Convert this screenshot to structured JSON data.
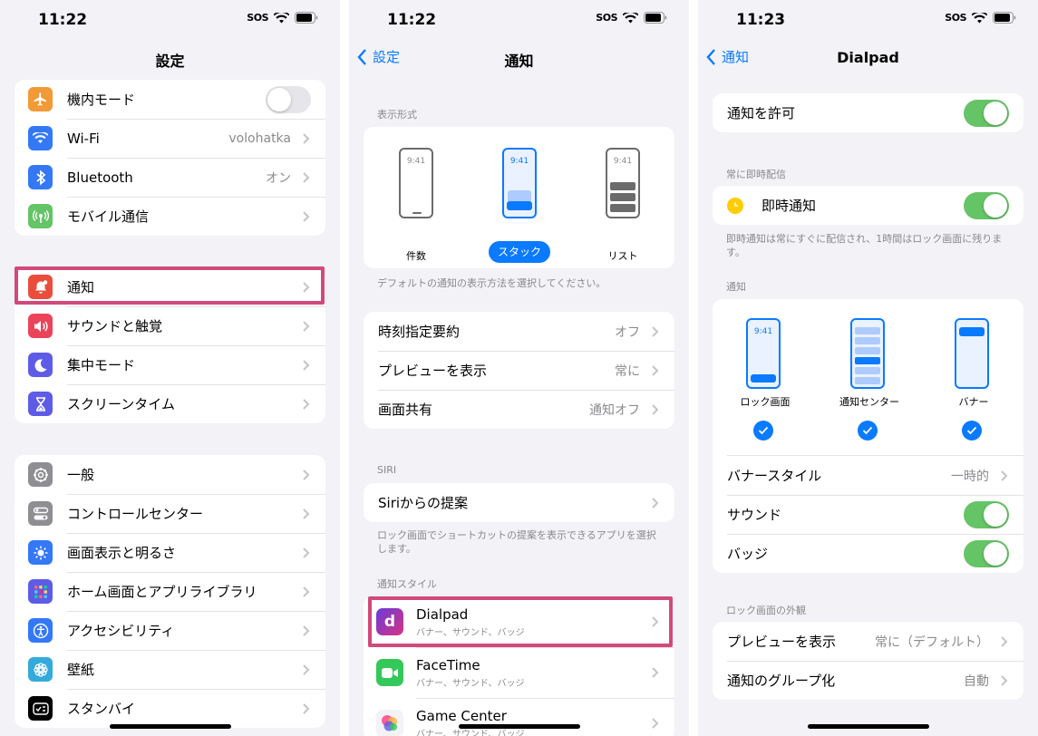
{
  "screen1": {
    "time": "11:22",
    "sos": "SOS",
    "title": "設定",
    "group1": [
      {
        "label": "機内モード",
        "icon": "airplane-icon",
        "color": "#f19a37",
        "toggle": "off"
      },
      {
        "label": "Wi-Fi",
        "value": "volohatka",
        "icon": "wifi-icon",
        "color": "#3478f6"
      },
      {
        "label": "Bluetooth",
        "value": "オン",
        "icon": "bluetooth-icon",
        "color": "#3478f6"
      },
      {
        "label": "モバイル通信",
        "icon": "antenna-icon",
        "color": "#65c466"
      }
    ],
    "group2": [
      {
        "label": "通知",
        "icon": "bell-badge-icon",
        "color": "#eb4d3d"
      },
      {
        "label": "サウンドと触覚",
        "icon": "speaker-icon",
        "color": "#eb445a"
      },
      {
        "label": "集中モード",
        "icon": "moon-icon",
        "color": "#5e5ce6"
      },
      {
        "label": "スクリーンタイム",
        "icon": "hourglass-icon",
        "color": "#5e5ce6"
      }
    ],
    "group3": [
      {
        "label": "一般",
        "icon": "gear-icon",
        "color": "#8e8e93"
      },
      {
        "label": "コントロールセンター",
        "icon": "switches-icon",
        "color": "#8e8e93"
      },
      {
        "label": "画面表示と明るさ",
        "icon": "sun-icon",
        "color": "#3478f6"
      },
      {
        "label": "ホーム画面とアプリライブラリ",
        "icon": "grid-icon",
        "color": "#5e5ce6"
      },
      {
        "label": "アクセシビリティ",
        "icon": "accessibility-icon",
        "color": "#3478f6"
      },
      {
        "label": "壁紙",
        "icon": "flower-icon",
        "color": "#34aadc"
      },
      {
        "label": "スタンバイ",
        "icon": "standby-icon",
        "color": "#000000"
      }
    ]
  },
  "screen2": {
    "time": "11:22",
    "sos": "SOS",
    "back": "設定",
    "title": "通知",
    "display_header": "表示形式",
    "styles": [
      {
        "label": "件数",
        "clock": "9:41",
        "selected": false
      },
      {
        "label": "スタック",
        "clock": "9:41",
        "selected": true
      },
      {
        "label": "リスト",
        "clock": "9:41",
        "selected": false
      }
    ],
    "display_footer": "デフォルトの通知の表示方法を選択してください。",
    "group_settings": [
      {
        "label": "時刻指定要約",
        "value": "オフ"
      },
      {
        "label": "プレビューを表示",
        "value": "常に"
      },
      {
        "label": "画面共有",
        "value": "通知オフ"
      }
    ],
    "siri_header": "SIRI",
    "siri_row": "Siriからの提案",
    "siri_footer": "ロック画面でショートカットの提案を表示できるアプリを選択します。",
    "style_header": "通知スタイル",
    "apps": [
      {
        "name": "Dialpad",
        "sub": "バナー、サウンド、バッジ",
        "icon": "dialpad-app-icon"
      },
      {
        "name": "FaceTime",
        "sub": "バナー、サウンド、バッジ",
        "icon": "facetime-app-icon"
      },
      {
        "name": "Game Center",
        "sub": "バナー、サウンド、バッジ",
        "icon": "game-center-app-icon"
      }
    ]
  },
  "screen3": {
    "time": "11:23",
    "sos": "SOS",
    "back": "通知",
    "title": "Dialpad",
    "allow_label": "通知を許可",
    "immediate_header": "常に即時配信",
    "immediate_label": "即時通知",
    "immediate_footer": "即時通知は常にすぐに配信され、1時間はロック画面に残ります。",
    "notif_header": "通知",
    "locations": [
      {
        "label": "ロック画面",
        "clock": "9:41"
      },
      {
        "label": "通知センター"
      },
      {
        "label": "バナー"
      }
    ],
    "banner_style_label": "バナースタイル",
    "banner_style_value": "一時的",
    "sound_label": "サウンド",
    "badge_label": "バッジ",
    "lock_header": "ロック画面の外観",
    "preview_label": "プレビューを表示",
    "preview_value": "常に（デフォルト）",
    "grouping_label": "通知のグループ化",
    "grouping_value": "自動"
  }
}
